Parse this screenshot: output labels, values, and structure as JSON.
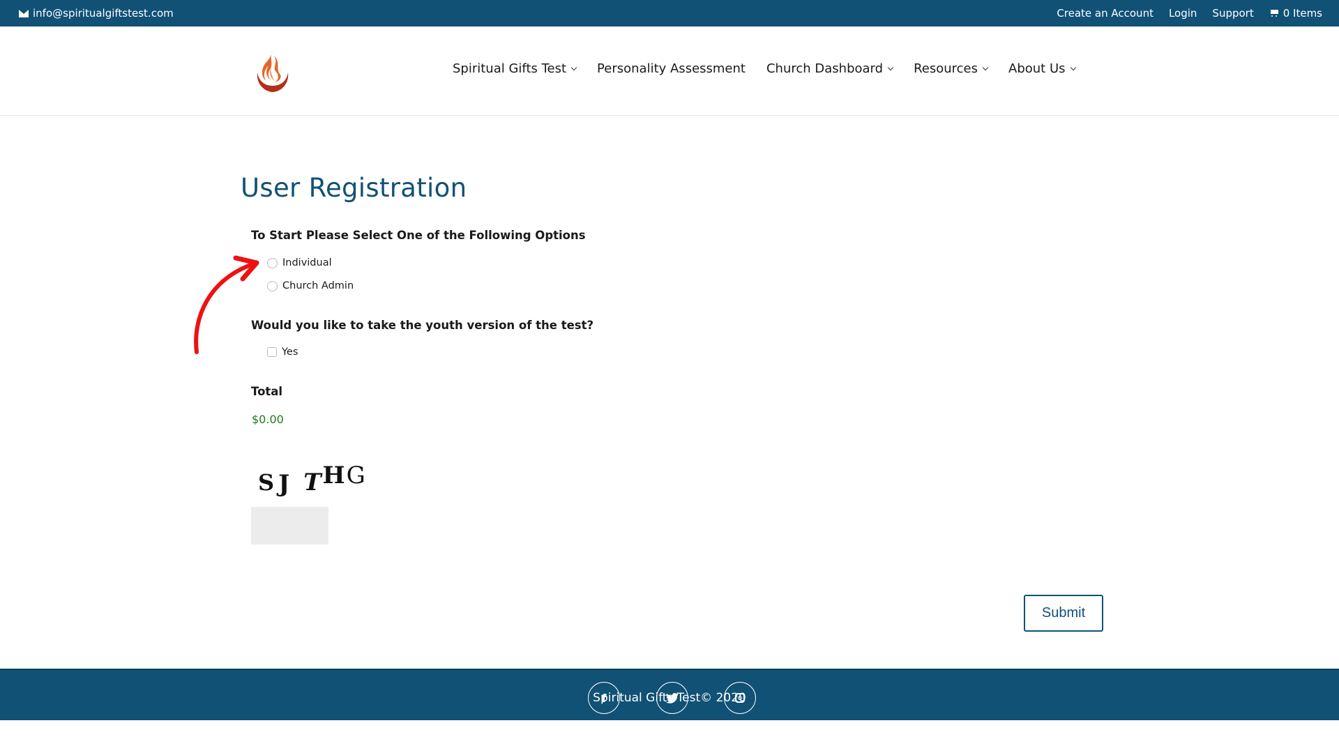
{
  "topbar": {
    "email": "info@spiritualgiftstest.com",
    "links": [
      "Create an Account",
      "Login",
      "Support"
    ],
    "cart": "0 Items"
  },
  "nav": {
    "items": [
      {
        "label": "Spiritual Gifts Test",
        "dropdown": true
      },
      {
        "label": "Personality Assessment",
        "dropdown": false
      },
      {
        "label": "Church Dashboard",
        "dropdown": true
      },
      {
        "label": "Resources",
        "dropdown": true
      },
      {
        "label": "About Us",
        "dropdown": true
      }
    ]
  },
  "page": {
    "title": "User Registration"
  },
  "form": {
    "options_label": "To Start Please Select One of the Following Options",
    "options": [
      "Individual",
      "Church Admin"
    ],
    "youth_label": "Would you like to take the youth version of the test?",
    "youth_option": "Yes",
    "total_label": "Total",
    "total_value": "$0.00",
    "captcha_text": [
      "S",
      "J",
      "T",
      "H",
      "G"
    ],
    "submit_label": "Submit"
  },
  "footer": {
    "copyright": "Spiritual Gifts Test© 2020",
    "social": [
      "facebook",
      "twitter",
      "instagram"
    ]
  },
  "colors": {
    "brand": "#115175",
    "total": "#1f7a1f",
    "annotation_arrow": "#ee1111"
  }
}
